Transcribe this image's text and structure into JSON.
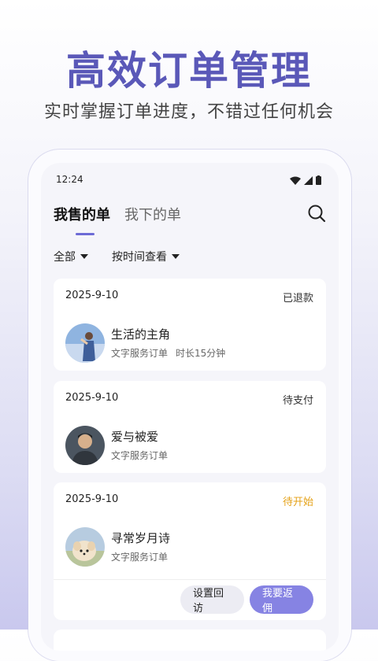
{
  "hero": {
    "title": "高效订单管理",
    "subtitle": "实时掌握订单进度，不错过任何机会"
  },
  "status_bar": {
    "time": "12:24"
  },
  "tabs": [
    {
      "label": "我售的单",
      "active": true
    },
    {
      "label": "我下的单",
      "active": false
    }
  ],
  "filters": [
    {
      "label": "全部"
    },
    {
      "label": "按时间查看"
    }
  ],
  "orders": [
    {
      "date": "2025-9-10",
      "status": "已退款",
      "name": "生活的主角",
      "type": "文字服务订单",
      "duration": "时长15分钟"
    },
    {
      "date": "2025-9-10",
      "status": "待支付",
      "name": "爱与被爱",
      "type": "文字服务订单",
      "duration": ""
    },
    {
      "date": "2025-9-10",
      "status": "待开始",
      "name": "寻常岁月诗",
      "type": "文字服务订单",
      "duration": "",
      "actions": {
        "secondary": "设置回访",
        "primary": "我要返佣"
      }
    }
  ],
  "colors": {
    "accent": "#6d6bd6",
    "title": "#5a58b8",
    "pending": "#e5a218",
    "primary_button": "#8683e3"
  }
}
